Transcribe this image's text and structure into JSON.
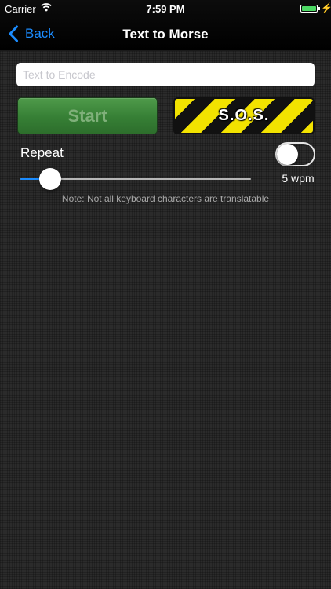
{
  "status_bar": {
    "carrier": "Carrier",
    "time": "7:59 PM",
    "battery_level": 1.0
  },
  "nav": {
    "back_label": "Back",
    "title": "Text to Morse"
  },
  "input": {
    "placeholder": "Text to Encode",
    "value": ""
  },
  "buttons": {
    "start_label": "Start",
    "sos_label": "S.O.S."
  },
  "repeat": {
    "label": "Repeat",
    "enabled": false
  },
  "speed": {
    "label": "5 wpm",
    "slider_fraction": 0.13
  },
  "note": "Note: Not all keyboard characters are translatable",
  "colors": {
    "accent": "#1b8cff",
    "battery": "#4cd964",
    "start_green": "#367f35",
    "sos_yellow": "#f2e200"
  },
  "icons": [
    "wifi-icon",
    "battery-icon",
    "charging-bolt-icon",
    "chevron-left-icon"
  ]
}
